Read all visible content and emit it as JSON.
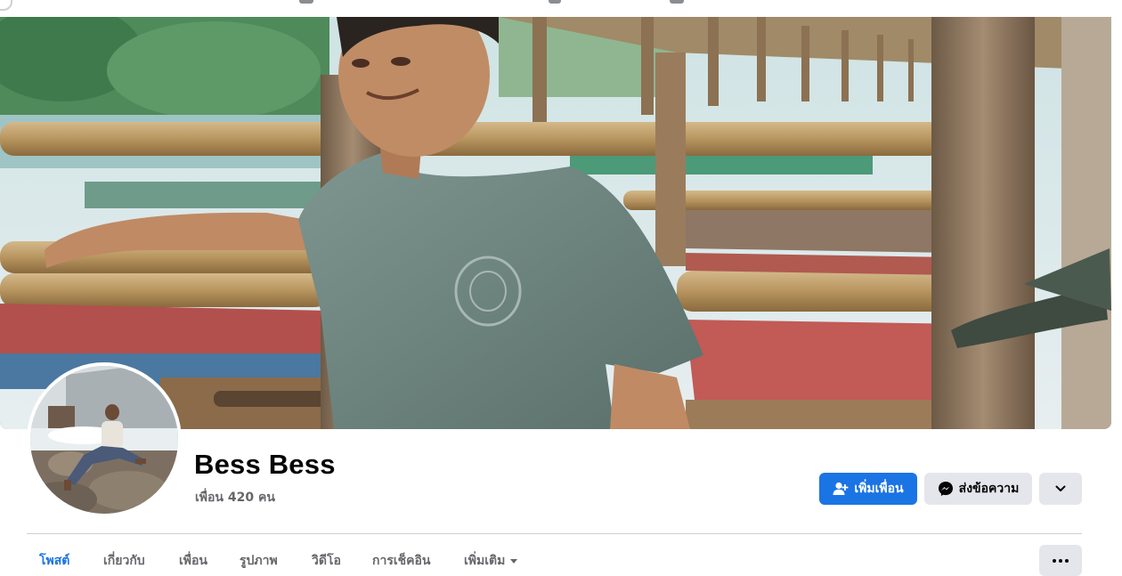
{
  "profile": {
    "name": "Bess Bess",
    "friends_count": "เพื่อน 420 คน"
  },
  "actions": {
    "add_friend_label": "เพิ่มเพื่อน",
    "message_label": "ส่งข้อความ",
    "more_icon": "chevron-down-icon"
  },
  "tabs": [
    {
      "label": "โพสต์",
      "active": true
    },
    {
      "label": "เกี่ยวกับ",
      "active": false
    },
    {
      "label": "เพื่อน",
      "active": false
    },
    {
      "label": "รูปภาพ",
      "active": false
    },
    {
      "label": "วิดีโอ",
      "active": false
    },
    {
      "label": "การเช็คอิน",
      "active": false
    },
    {
      "label": "เพิ่มเติม",
      "active": false
    }
  ],
  "colors": {
    "accent": "#1b74e4",
    "button_gray": "#e4e6eb",
    "secondary_text": "#65676b"
  }
}
